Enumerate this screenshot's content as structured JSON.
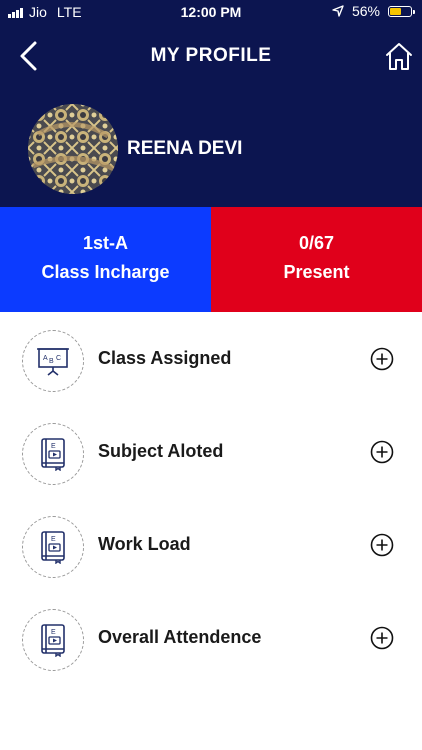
{
  "status_bar": {
    "carrier": "Jio",
    "network": "LTE",
    "time": "12:00 PM",
    "battery_percent": "56%",
    "battery_level": 0.56,
    "battery_color": "#f6c500"
  },
  "header": {
    "title": "MY PROFILE",
    "back_icon": "chevron-left-icon",
    "home_icon": "home-icon",
    "background_color": "#0c1550"
  },
  "profile": {
    "name": "REENA DEVI"
  },
  "stats": {
    "class": {
      "value": "1st-A",
      "label": "Class Incharge",
      "color": "#0c3bff"
    },
    "attendance": {
      "value": "0/67",
      "label": "Present",
      "color": "#e0001b"
    }
  },
  "menu": [
    {
      "label": "Class Assigned",
      "icon": "abc-board-icon"
    },
    {
      "label": "Subject Aloted",
      "icon": "ebook-icon"
    },
    {
      "label": "Work Load",
      "icon": "ebook-icon"
    },
    {
      "label": "Overall Attendence",
      "icon": "ebook-icon"
    }
  ]
}
